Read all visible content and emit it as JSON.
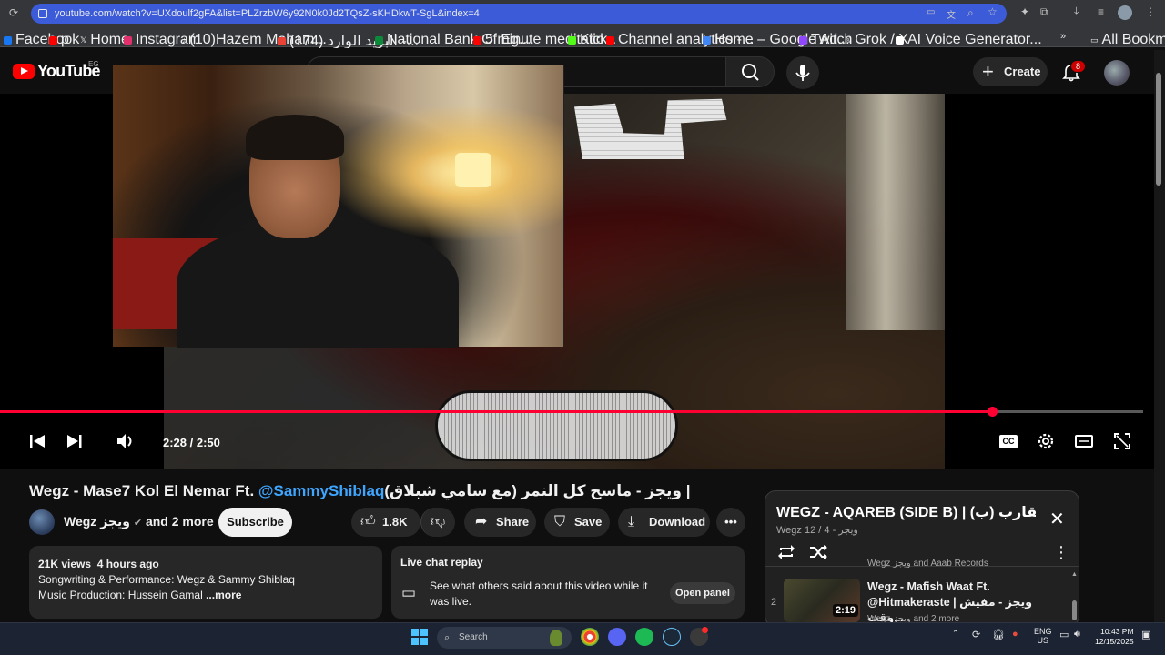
{
  "browser": {
    "url": "youtube.com/watch?v=UXdoulf2gFA&list=PLZrzbW6y92N0k0Jd2TQsZ-sKHDkwT-SgL&index=4",
    "bookmarks": [
      {
        "label": "Facebook",
        "color": "#1877f2"
      },
      {
        "label": "p",
        "color": "#ff0000"
      },
      {
        "label": "Home",
        "color": "#ffffff"
      },
      {
        "label": "Instagram",
        "color": "#e1306c"
      },
      {
        "label": "(10)Hazem Moham...",
        "color": "#ffffff"
      },
      {
        "label": "(174) البريد الوارد -...",
        "color": "#ea4335"
      },
      {
        "label": "National Bank Of Eg...",
        "color": "#0b8a3a"
      },
      {
        "label": "5 minute meditatio...",
        "color": "#ff0000"
      },
      {
        "label": "Kick",
        "color": "#53fc18"
      },
      {
        "label": "Channel analytics -...",
        "color": "#ff0000"
      },
      {
        "label": "Home – Google Ad...",
        "color": "#4285f4"
      },
      {
        "label": "Twitch",
        "color": "#9146ff"
      },
      {
        "label": "Grok / X",
        "color": "#ffffff"
      },
      {
        "label": "AI Voice Generator...",
        "color": "#ffffff"
      }
    ],
    "all_bookmarks": "All Bookmarks"
  },
  "header": {
    "logo_text": "YouTube",
    "country_code": "EG",
    "create_label": "Create",
    "notification_count": "8"
  },
  "player": {
    "current_time": "2:28 / 2:50",
    "progress_fraction": 0.868
  },
  "video": {
    "title_prefix": "Wegz - Mase7 Kol El Nemar Ft. ",
    "title_mention": "@SammyShiblaq",
    "title_suffix": "(ويجز - ماسح كل النمر (مع سامي شبلاق |",
    "channel": "Wegz ويجز",
    "channel_suffix": "and 2 more",
    "subscribe_label": "Subscribe",
    "likes": "1.8K",
    "share_label": "Share",
    "save_label": "Save",
    "download_label": "Download"
  },
  "description": {
    "views": "21K views",
    "age": "4 hours ago",
    "line1": "Songwriting & Performance: Wegz & Sammy Shiblaq",
    "line2": "Music Production: Hussein Gamal",
    "more": "...more"
  },
  "chat": {
    "heading": "Live chat replay",
    "text": "See what others said about this video while it was live.",
    "open_panel": "Open panel"
  },
  "playlist": {
    "title": "WEGZ - AQAREB (SIDE B) | (ب) عقارب",
    "channel": "Wegz ويجز",
    "position": "4 / 12",
    "item": {
      "index": "2",
      "title": "Wegz - Mafish Waat Ft. @Hitmakeraste | ويجز - مفيش وقت...",
      "channel": "Wegz ويجز and 2 more",
      "duration": "2:19"
    },
    "above_item_channel": "Wegz ويجز and Aaab Records"
  },
  "taskbar": {
    "search_placeholder": "Search",
    "lang_top": "ENG",
    "lang_bottom": "US",
    "time": "10:43 PM",
    "date": "12/15/2025"
  }
}
